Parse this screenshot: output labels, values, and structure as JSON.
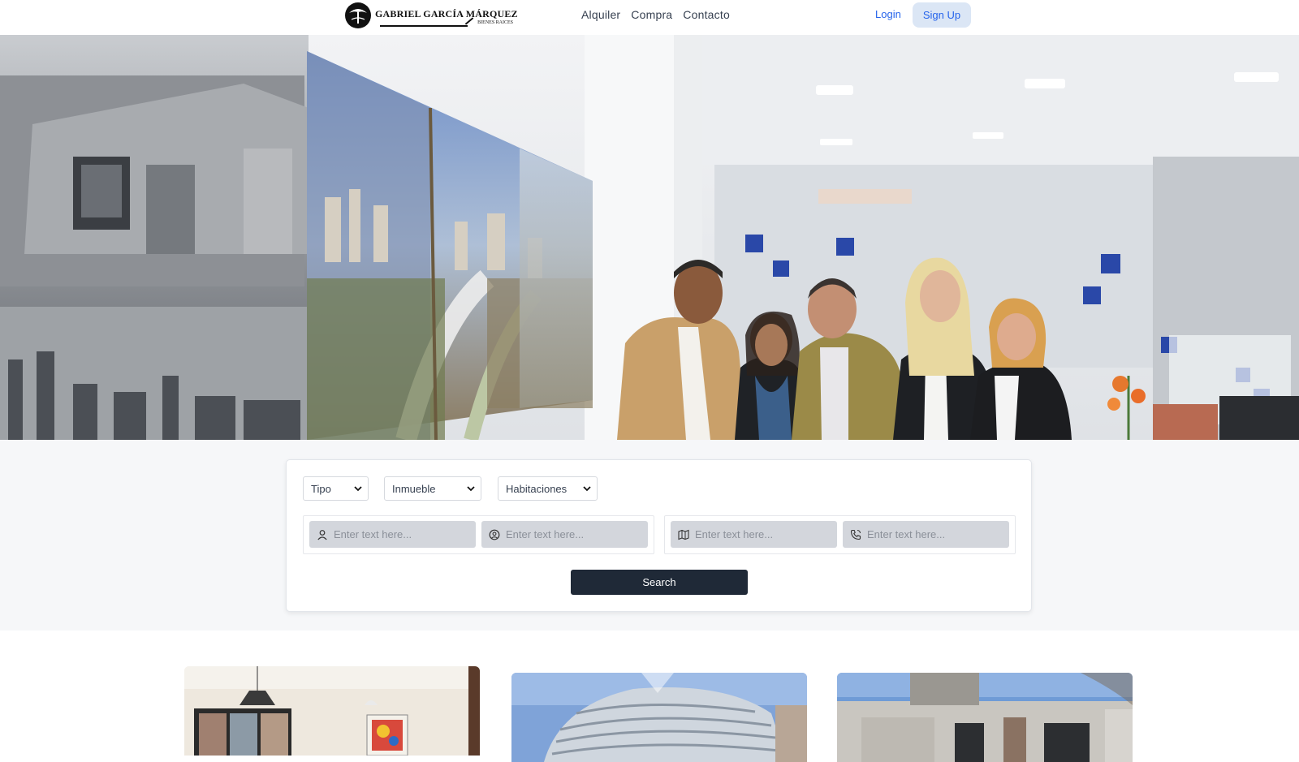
{
  "brand": {
    "name": "GABRIEL GARCÍA MÁRQUEZ",
    "tagline": "BIENES RAICES"
  },
  "nav": {
    "links": [
      "Alquiler",
      "Compra",
      "Contacto"
    ],
    "login_label": "Login",
    "signup_label": "Sign Up"
  },
  "search": {
    "filters": {
      "tipo": "Tipo",
      "inmueble": "Inmueble",
      "habitaciones": "Habitaciones"
    },
    "fields": [
      {
        "icon": "user-icon",
        "placeholder": "Enter text here..."
      },
      {
        "icon": "face-icon",
        "placeholder": "Enter text here..."
      },
      {
        "icon": "map-icon",
        "placeholder": "Enter text here..."
      },
      {
        "icon": "phone-icon",
        "placeholder": "Enter text here..."
      }
    ],
    "button_label": "Search"
  },
  "colors": {
    "accent": "#2563eb",
    "signup_bg": "#dbe6f5",
    "search_button": "#1f2937",
    "field_bg": "#d3d6dc"
  }
}
